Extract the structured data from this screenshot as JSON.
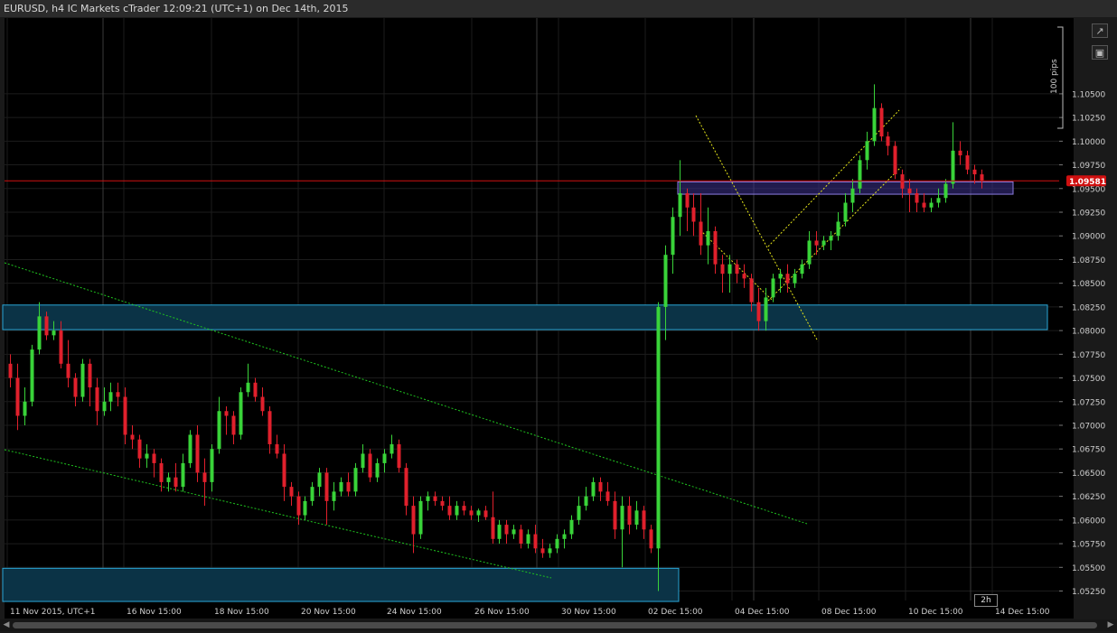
{
  "window": {
    "title": "EURUSD, h4 IC Markets cTrader 12:09:21 (UTC+1) on Dec 14th, 2015"
  },
  "toolbar": {
    "detach_icon": "detach-icon",
    "camera_icon": "camera-icon"
  },
  "timeframe_badge": "2h",
  "pips_label": "100 pips",
  "current_price": "1.09581",
  "colors": {
    "bull": "#39d339",
    "bear": "#e0202c",
    "price_line": "#d01010",
    "zone_fill": "#0b3346",
    "zone_border": "#2aa6d6",
    "purple_zone": "#8a7ce0",
    "trend_green": "#1fc51f",
    "trend_yellow": "#e6e619"
  },
  "chart_data": {
    "type": "candlestick",
    "symbol": "EURUSD",
    "timeframe": "h4",
    "y_range": [
      1.0515,
      1.113
    ],
    "y_ticks": [
      "1.10500",
      "1.10250",
      "1.10000",
      "1.09750",
      "1.09500",
      "1.09250",
      "1.09000",
      "1.08750",
      "1.08500",
      "1.08250",
      "1.08000",
      "1.07750",
      "1.07500",
      "1.07250",
      "1.07000",
      "1.06750",
      "1.06500",
      "1.06250",
      "1.06000",
      "1.05750",
      "1.05500",
      "1.05250"
    ],
    "x_ticks": [
      "11 Nov 2015, UTC+1",
      "16 Nov 15:00",
      "18 Nov 15:00",
      "20 Nov 15:00",
      "24 Nov 15:00",
      "26 Nov 15:00",
      "30 Nov 15:00",
      "02 Dec 15:00",
      "04 Dec 15:00",
      "08 Dec 15:00",
      "10 Dec 15:00",
      "14 Dec 15:00"
    ],
    "current_price": 1.09581,
    "zones": [
      {
        "name": "upper-demand-zone",
        "from": 1.0801,
        "to": 1.0827
      },
      {
        "name": "lower-demand-zone",
        "from": 1.0514,
        "to": 1.0549
      },
      {
        "name": "resistance-zone",
        "from": 1.0944,
        "to": 1.0957
      }
    ],
    "candles": [
      [
        1.0765,
        1.0775,
        1.074,
        1.075
      ],
      [
        1.075,
        1.0765,
        1.0695,
        1.071
      ],
      [
        1.071,
        1.074,
        1.07,
        1.0725
      ],
      [
        1.0725,
        1.0785,
        1.072,
        1.078
      ],
      [
        1.078,
        1.083,
        1.0775,
        1.0815
      ],
      [
        1.0815,
        1.082,
        1.079,
        1.0795
      ],
      [
        1.0795,
        1.081,
        1.079,
        1.08
      ],
      [
        1.08,
        1.081,
        1.076,
        1.0765
      ],
      [
        1.0765,
        1.079,
        1.074,
        1.075
      ],
      [
        1.075,
        1.0755,
        1.072,
        1.073
      ],
      [
        1.073,
        1.077,
        1.0725,
        1.0765
      ],
      [
        1.0765,
        1.077,
        1.072,
        1.074
      ],
      [
        1.074,
        1.075,
        1.07,
        1.0715
      ],
      [
        1.0715,
        1.074,
        1.071,
        1.0725
      ],
      [
        1.0725,
        1.0745,
        1.0715,
        1.0735
      ],
      [
        1.0735,
        1.0745,
        1.072,
        1.073
      ],
      [
        1.073,
        1.074,
        1.068,
        1.069
      ],
      [
        1.069,
        1.07,
        1.0675,
        1.0685
      ],
      [
        1.0685,
        1.069,
        1.0655,
        1.0665
      ],
      [
        1.0665,
        1.068,
        1.0655,
        1.067
      ],
      [
        1.067,
        1.0675,
        1.0645,
        1.066
      ],
      [
        1.066,
        1.0665,
        1.063,
        1.064
      ],
      [
        1.064,
        1.065,
        1.063,
        1.0645
      ],
      [
        1.0645,
        1.066,
        1.063,
        1.0635
      ],
      [
        1.0635,
        1.067,
        1.063,
        1.066
      ],
      [
        1.066,
        1.0695,
        1.0655,
        1.069
      ],
      [
        1.069,
        1.07,
        1.064,
        1.065
      ],
      [
        1.065,
        1.0665,
        1.0615,
        1.064
      ],
      [
        1.064,
        1.068,
        1.063,
        1.0675
      ],
      [
        1.0675,
        1.073,
        1.067,
        1.0715
      ],
      [
        1.0715,
        1.072,
        1.069,
        1.071
      ],
      [
        1.071,
        1.0715,
        1.068,
        1.069
      ],
      [
        1.069,
        1.074,
        1.0685,
        1.0735
      ],
      [
        1.0735,
        1.0765,
        1.073,
        1.0745
      ],
      [
        1.0745,
        1.075,
        1.0725,
        1.073
      ],
      [
        1.073,
        1.074,
        1.071,
        1.0715
      ],
      [
        1.0715,
        1.072,
        1.067,
        1.068
      ],
      [
        1.068,
        1.069,
        1.0665,
        1.067
      ],
      [
        1.067,
        1.068,
        1.062,
        1.0635
      ],
      [
        1.0635,
        1.064,
        1.0615,
        1.0625
      ],
      [
        1.0625,
        1.063,
        1.0595,
        1.0605
      ],
      [
        1.0605,
        1.0625,
        1.06,
        1.062
      ],
      [
        1.062,
        1.064,
        1.0615,
        1.0635
      ],
      [
        1.0635,
        1.0655,
        1.0625,
        1.065
      ],
      [
        1.065,
        1.0655,
        1.0595,
        1.062
      ],
      [
        1.062,
        1.064,
        1.061,
        1.063
      ],
      [
        1.063,
        1.0645,
        1.0625,
        1.064
      ],
      [
        1.064,
        1.065,
        1.0625,
        1.063
      ],
      [
        1.063,
        1.066,
        1.0625,
        1.0655
      ],
      [
        1.0655,
        1.068,
        1.065,
        1.067
      ],
      [
        1.067,
        1.0675,
        1.064,
        1.0645
      ],
      [
        1.0645,
        1.0665,
        1.064,
        1.066
      ],
      [
        1.066,
        1.0675,
        1.065,
        1.067
      ],
      [
        1.067,
        1.069,
        1.0665,
        1.068
      ],
      [
        1.068,
        1.0685,
        1.065,
        1.0655
      ],
      [
        1.0655,
        1.066,
        1.0605,
        1.0615
      ],
      [
        1.0615,
        1.0625,
        1.0565,
        1.0585
      ],
      [
        1.0585,
        1.0625,
        1.058,
        1.062
      ],
      [
        1.062,
        1.063,
        1.061,
        1.0625
      ],
      [
        1.0625,
        1.063,
        1.0615,
        1.062
      ],
      [
        1.062,
        1.0625,
        1.061,
        1.0615
      ],
      [
        1.0615,
        1.0625,
        1.06,
        1.0605
      ],
      [
        1.0605,
        1.062,
        1.06,
        1.0615
      ],
      [
        1.0615,
        1.062,
        1.0605,
        1.061
      ],
      [
        1.061,
        1.0615,
        1.06,
        1.0605
      ],
      [
        1.0605,
        1.0612,
        1.0598,
        1.061
      ],
      [
        1.061,
        1.0615,
        1.06,
        1.0603
      ],
      [
        1.0603,
        1.063,
        1.0575,
        1.058
      ],
      [
        1.058,
        1.06,
        1.0575,
        1.0595
      ],
      [
        1.0595,
        1.06,
        1.0575,
        1.0585
      ],
      [
        1.0585,
        1.0595,
        1.058,
        1.059
      ],
      [
        1.059,
        1.0595,
        1.057,
        1.0575
      ],
      [
        1.0575,
        1.059,
        1.057,
        1.0585
      ],
      [
        1.0585,
        1.0595,
        1.0565,
        1.057
      ],
      [
        1.057,
        1.058,
        1.056,
        1.0565
      ],
      [
        1.0565,
        1.0575,
        1.056,
        1.057
      ],
      [
        1.057,
        1.0585,
        1.0565,
        1.058
      ],
      [
        1.058,
        1.059,
        1.057,
        1.0585
      ],
      [
        1.0585,
        1.0605,
        1.058,
        1.06
      ],
      [
        1.06,
        1.0625,
        1.0595,
        1.0615
      ],
      [
        1.0615,
        1.0635,
        1.061,
        1.0625
      ],
      [
        1.0625,
        1.0645,
        1.062,
        1.064
      ],
      [
        1.064,
        1.0645,
        1.062,
        1.063
      ],
      [
        1.063,
        1.064,
        1.0615,
        1.062
      ],
      [
        1.062,
        1.063,
        1.058,
        1.059
      ],
      [
        1.059,
        1.0625,
        1.055,
        1.0615
      ],
      [
        1.0615,
        1.0625,
        1.0585,
        1.0595
      ],
      [
        1.0595,
        1.062,
        1.059,
        1.061
      ],
      [
        1.061,
        1.0615,
        1.058,
        1.059
      ],
      [
        1.059,
        1.0595,
        1.0565,
        1.057
      ],
      [
        1.057,
        1.083,
        1.0525,
        1.0825
      ],
      [
        1.0825,
        1.089,
        1.079,
        1.088
      ],
      [
        1.088,
        1.093,
        1.086,
        1.092
      ],
      [
        1.092,
        1.098,
        1.09,
        1.0945
      ],
      [
        1.0945,
        1.095,
        1.0905,
        1.093
      ],
      [
        1.093,
        1.0945,
        1.09,
        1.0915
      ],
      [
        1.0915,
        1.0945,
        1.088,
        1.089
      ],
      [
        1.089,
        1.093,
        1.087,
        1.0905
      ],
      [
        1.0905,
        1.091,
        1.086,
        1.087
      ],
      [
        1.087,
        1.088,
        1.084,
        1.086
      ],
      [
        1.086,
        1.088,
        1.084,
        1.087
      ],
      [
        1.087,
        1.0875,
        1.085,
        1.086
      ],
      [
        1.086,
        1.087,
        1.0845,
        1.0855
      ],
      [
        1.0855,
        1.086,
        1.082,
        1.083
      ],
      [
        1.083,
        1.0845,
        1.08,
        1.081
      ],
      [
        1.081,
        1.0845,
        1.08,
        1.0835
      ],
      [
        1.0835,
        1.086,
        1.083,
        1.0855
      ],
      [
        1.0855,
        1.0865,
        1.084,
        1.086
      ],
      [
        1.086,
        1.087,
        1.084,
        1.085
      ],
      [
        1.085,
        1.0865,
        1.0845,
        1.086
      ],
      [
        1.086,
        1.0875,
        1.0855,
        1.087
      ],
      [
        1.087,
        1.0905,
        1.0865,
        1.0895
      ],
      [
        1.0895,
        1.0905,
        1.088,
        1.089
      ],
      [
        1.089,
        1.09,
        1.0885,
        1.0895
      ],
      [
        1.0895,
        1.0905,
        1.0885,
        1.09
      ],
      [
        1.09,
        1.0925,
        1.0895,
        1.0915
      ],
      [
        1.0915,
        1.0945,
        1.091,
        1.0935
      ],
      [
        1.0935,
        1.096,
        1.0925,
        1.095
      ],
      [
        1.095,
        1.0985,
        1.0945,
        1.098
      ],
      [
        1.098,
        1.101,
        1.097,
        1.1
      ],
      [
        1.1,
        1.106,
        1.0995,
        1.1035
      ],
      [
        1.1035,
        1.104,
        1.1,
        1.1005
      ],
      [
        1.1005,
        1.101,
        1.0985,
        1.0995
      ],
      [
        1.0995,
        1.1,
        1.096,
        1.0965
      ],
      [
        1.0965,
        1.097,
        1.094,
        1.095
      ],
      [
        1.095,
        1.096,
        1.0925,
        1.0945
      ],
      [
        1.0945,
        1.095,
        1.0925,
        1.0935
      ],
      [
        1.0935,
        1.0945,
        1.0925,
        1.093
      ],
      [
        1.093,
        1.094,
        1.0925,
        1.0935
      ],
      [
        1.0935,
        1.095,
        1.093,
        1.094
      ],
      [
        1.094,
        1.096,
        1.0935,
        1.0955
      ],
      [
        1.0955,
        1.102,
        1.095,
        1.099
      ],
      [
        1.099,
        1.1,
        1.0975,
        1.0985
      ],
      [
        1.0985,
        1.099,
        1.0965,
        1.097
      ],
      [
        1.097,
        1.0975,
        1.0955,
        1.0965
      ],
      [
        1.0965,
        1.097,
        1.095,
        1.0958
      ]
    ]
  }
}
